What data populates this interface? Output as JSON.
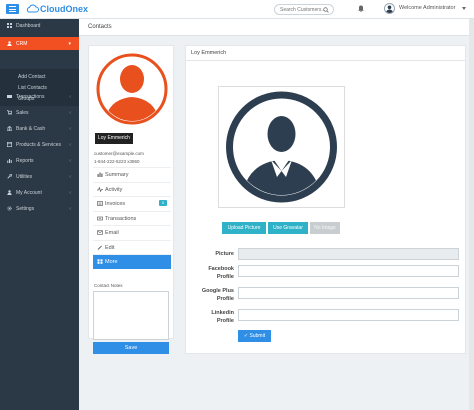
{
  "app": {
    "brand": "CloudOnex",
    "search_placeholder": "Search Customers...",
    "user_greeting": "Welcome Administrator"
  },
  "sidebar": {
    "items": [
      {
        "label": "Dashboard",
        "icon": "dashboard-icon"
      },
      {
        "label": "CRM",
        "icon": "users-icon",
        "active": true
      },
      {
        "label": "Transactions",
        "icon": "transactions-icon"
      },
      {
        "label": "Sales",
        "icon": "cart-icon"
      },
      {
        "label": "Bank & Cash",
        "icon": "bank-icon"
      },
      {
        "label": "Products & Services",
        "icon": "box-icon"
      },
      {
        "label": "Reports",
        "icon": "chart-icon"
      },
      {
        "label": "Utilities",
        "icon": "wrench-icon"
      },
      {
        "label": "My Account",
        "icon": "user-icon"
      },
      {
        "label": "Settings",
        "icon": "gear-icon"
      }
    ],
    "crm_sub": [
      "Add Contact",
      "List Contacts",
      "Groups"
    ]
  },
  "page": {
    "title": "Contacts"
  },
  "contact": {
    "name": "Loy Emmerich",
    "email": "customer@example.com",
    "phone": "1-844-222-5223 x3860"
  },
  "contact_menu": {
    "summary": "Summary",
    "activity": "Activity",
    "invoices": "Invoices",
    "invoices_count": "0",
    "transactions": "Transactions",
    "email": "Email",
    "edit": "Edit",
    "more": "More"
  },
  "notes": {
    "label": "Contact Notes",
    "value": "",
    "save": "Save"
  },
  "edit_panel": {
    "title": "Loy Emmerich",
    "upload": "Upload Picture",
    "gravatar": "Use Gravatar",
    "no_image": "No Image",
    "picture_label": "Picture",
    "facebook_label_1": "Facebook",
    "facebook_label_2": "Profile",
    "google_label_1": "Google Plus",
    "google_label_2": "Profile",
    "linkedin_label_1": "Linkedin",
    "linkedin_label_2": "Profile",
    "submit": "Submit"
  },
  "colors": {
    "accent": "#2f8ee5",
    "crm_active": "#f25022",
    "sidebar_bg": "#2b3845",
    "info": "#2fb2c8",
    "avatar_orange": "#e8501e",
    "avatar_dark": "#2c3e50"
  }
}
